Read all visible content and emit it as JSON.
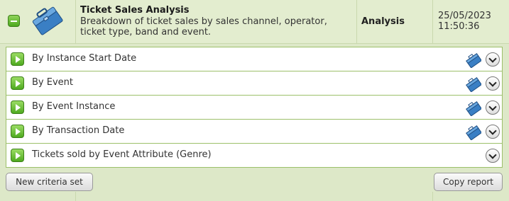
{
  "report": {
    "title": "Ticket Sales Analysis",
    "description": "Breakdown of ticket sales by sales channel, operator, ticket type, band and event.",
    "type": "Analysis",
    "date": "25/05/2023",
    "time": "11:50:36"
  },
  "criteria": [
    {
      "label": "By Instance Start Date",
      "has_toolbox": true
    },
    {
      "label": "By Event",
      "has_toolbox": true
    },
    {
      "label": "By Event Instance",
      "has_toolbox": true
    },
    {
      "label": "By Transaction Date",
      "has_toolbox": true
    },
    {
      "label": "Tickets sold by Event Attribute (Genre)",
      "has_toolbox": false
    }
  ],
  "buttons": {
    "new_criteria": "New criteria set",
    "copy_report": "Copy report"
  },
  "colors": {
    "panel_bg": "#e3edcf",
    "accent_green": "#4ea91f",
    "border_green": "#9cc06a",
    "toolbox_blue": "#3a7fc4"
  }
}
